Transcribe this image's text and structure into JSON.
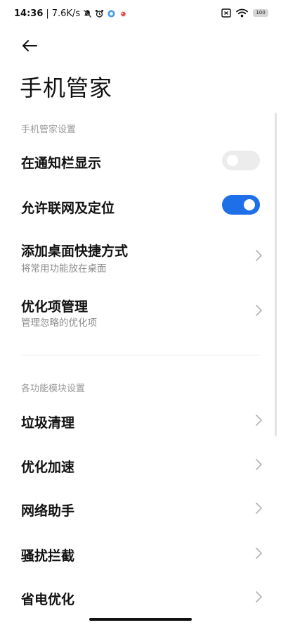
{
  "status_bar": {
    "time": "14:36",
    "separator": "|",
    "net_speed": "7.6K/s",
    "battery": "100",
    "icons": [
      "mute-notification-icon",
      "alarm-icon",
      "app-notification-icon",
      "app-notification-icon-2",
      "sim-icon",
      "wifi-icon",
      "battery-icon"
    ]
  },
  "header": {
    "back_icon": "back-arrow-icon",
    "title": "手机管家"
  },
  "sections": {
    "settings_label": "手机管家设置",
    "modules_label": "各功能模块设置"
  },
  "settings_rows": {
    "notification_bar": {
      "title": "在通知栏显示",
      "enabled": false
    },
    "network_location": {
      "title": "允许联网及定位",
      "enabled": true
    },
    "desktop_shortcut": {
      "title": "添加桌面快捷方式",
      "subtitle": "将常用功能放在桌面"
    },
    "optimization_items": {
      "title": "优化项管理",
      "subtitle": "管理忽略的优化项"
    }
  },
  "module_rows": [
    {
      "title": "垃圾清理"
    },
    {
      "title": "优化加速"
    },
    {
      "title": "网络助手"
    },
    {
      "title": "骚扰拦截"
    },
    {
      "title": "省电优化"
    }
  ],
  "colors": {
    "accent": "#1e6fe8",
    "toggle_off": "#ececec",
    "secondary_text": "#999999"
  }
}
